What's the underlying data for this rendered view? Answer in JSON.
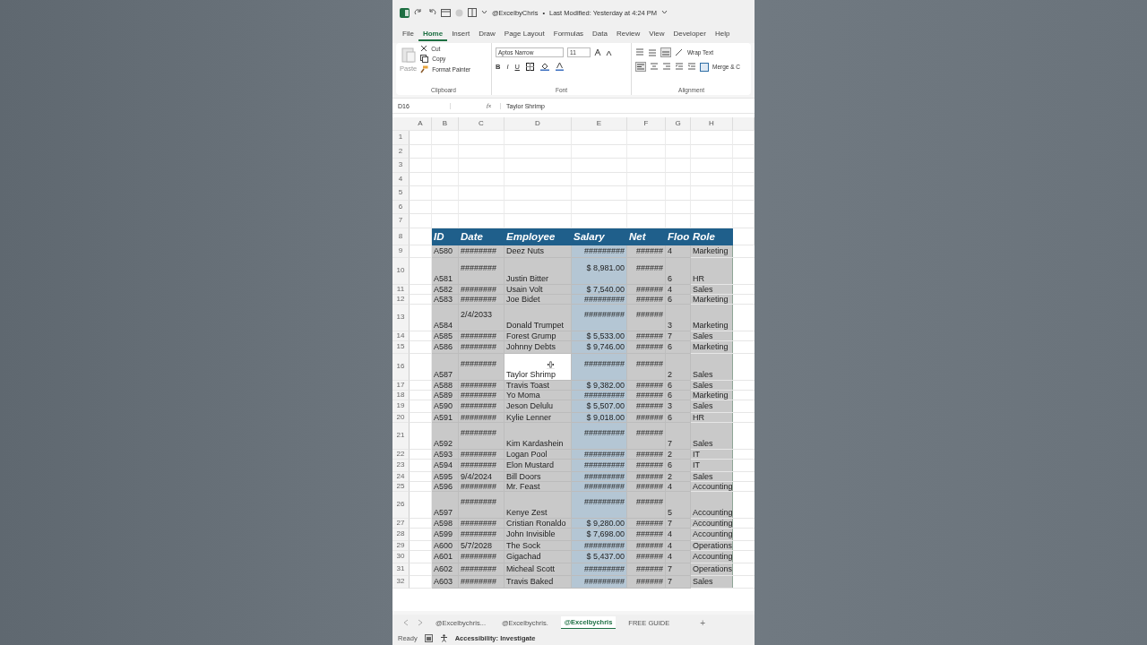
{
  "title_bar": {
    "file": "@ExcelbyChris",
    "separator": "•",
    "modified": "Last Modified: Yesterday at 4:24 PM"
  },
  "menu_tabs": [
    {
      "label": "File",
      "selected": false
    },
    {
      "label": "Home",
      "selected": true
    },
    {
      "label": "Insert",
      "selected": false
    },
    {
      "label": "Draw",
      "selected": false
    },
    {
      "label": "Page Layout",
      "selected": false
    },
    {
      "label": "Formulas",
      "selected": false
    },
    {
      "label": "Data",
      "selected": false
    },
    {
      "label": "Review",
      "selected": false
    },
    {
      "label": "View",
      "selected": false
    },
    {
      "label": "Developer",
      "selected": false
    },
    {
      "label": "Help",
      "selected": false
    }
  ],
  "ribbon": {
    "clipboard": {
      "paste": "Paste",
      "cut": "Cut",
      "copy": "Copy",
      "format_painter": "Format Painter",
      "group": "Clipboard"
    },
    "font": {
      "name": "Aptos Narrow",
      "size": "11",
      "bold": "B",
      "italic": "I",
      "underline": "U",
      "group": "Font"
    },
    "alignment": {
      "wrap": "Wrap Text",
      "merge": "Merge & C",
      "group": "Alignment"
    }
  },
  "formula_bar": {
    "cell": "D16",
    "fx": "fx",
    "value": "Taylor Shrimp"
  },
  "columns": [
    "A",
    "B",
    "C",
    "D",
    "E",
    "F",
    "G",
    "H"
  ],
  "empty_rows": [
    "1",
    "2",
    "3",
    "4",
    "5",
    "6",
    "7"
  ],
  "table": {
    "header_row": "8",
    "headers": [
      "ID",
      "Date",
      "Employee",
      "Salary",
      "Net",
      "Floo",
      "Role"
    ],
    "rows": [
      {
        "num": "9",
        "kind": "normal",
        "active": false,
        "cells": [
          "A580",
          "########",
          "Deez Nuts",
          "#########",
          "######",
          "4",
          "Marketing"
        ]
      },
      {
        "num": "10",
        "kind": "tall",
        "active": false,
        "cells": [
          "A581",
          "########",
          "Justin Bitter",
          "$ 8,981.00",
          "######",
          "6",
          "HR"
        ]
      },
      {
        "num": "11",
        "kind": "short",
        "active": false,
        "cells": [
          "A582",
          "########",
          "Usain Volt",
          "$ 7,540.00",
          "######",
          "4",
          "Sales"
        ]
      },
      {
        "num": "12",
        "kind": "short",
        "active": false,
        "cells": [
          "A583",
          "########",
          "Joe Bidet",
          "#########",
          "######",
          "6",
          "Marketing"
        ]
      },
      {
        "num": "13",
        "kind": "tall",
        "active": false,
        "cells": [
          "A584",
          "2/4/2033",
          "Donald Trumpet",
          "#########",
          "######",
          "3",
          "Marketing"
        ]
      },
      {
        "num": "14",
        "kind": "short",
        "active": false,
        "cells": [
          "A585",
          "########",
          "Forest Grump",
          "$ 5,533.00",
          "######",
          "7",
          "Sales"
        ]
      },
      {
        "num": "15",
        "kind": "normal",
        "active": false,
        "cells": [
          "A586",
          "########",
          "Johnny Debts",
          "$ 9,746.00",
          "######",
          "6",
          "Marketing"
        ]
      },
      {
        "num": "16",
        "kind": "tall",
        "active": true,
        "cells": [
          "A587",
          "########",
          "Taylor Shrimp",
          "#########",
          "######",
          "2",
          "Sales"
        ]
      },
      {
        "num": "17",
        "kind": "short",
        "active": false,
        "cells": [
          "A588",
          "########",
          "Travis Toast",
          "$ 9,382.00",
          "######",
          "6",
          "Sales"
        ]
      },
      {
        "num": "18",
        "kind": "short",
        "active": false,
        "cells": [
          "A589",
          "########",
          "Yo Moma",
          "#########",
          "######",
          "6",
          "Marketing"
        ]
      },
      {
        "num": "19",
        "kind": "normal",
        "active": false,
        "cells": [
          "A590",
          "########",
          "Jeson Delulu",
          "$ 5,507.00",
          "######",
          "3",
          "Sales"
        ]
      },
      {
        "num": "20",
        "kind": "short",
        "active": false,
        "cells": [
          "A591",
          "########",
          "Kylie Lenner",
          "$ 9,018.00",
          "######",
          "6",
          "HR"
        ]
      },
      {
        "num": "21",
        "kind": "tall",
        "active": false,
        "cells": [
          "A592",
          "########",
          "Kim Kardashein",
          "#########",
          "######",
          "7",
          "Sales"
        ]
      },
      {
        "num": "22",
        "kind": "short",
        "active": false,
        "cells": [
          "A593",
          "########",
          "Logan Pool",
          "#########",
          "######",
          "2",
          "IT"
        ]
      },
      {
        "num": "23",
        "kind": "normal",
        "active": false,
        "cells": [
          "A594",
          "########",
          "Elon Mustard",
          "#########",
          "######",
          "6",
          "IT"
        ]
      },
      {
        "num": "24",
        "kind": "short",
        "active": false,
        "cells": [
          "A595",
          "9/4/2024",
          "Bill Doors",
          "#########",
          "######",
          "2",
          "Sales"
        ]
      },
      {
        "num": "25",
        "kind": "short",
        "active": false,
        "cells": [
          "A596",
          "########",
          "Mr. Feast",
          "#########",
          "######",
          "4",
          "Accounting"
        ]
      },
      {
        "num": "26",
        "kind": "tall",
        "active": false,
        "cells": [
          "A597",
          "########",
          "Kenye Zest",
          "#########",
          "######",
          "5",
          "Accounting"
        ]
      },
      {
        "num": "27",
        "kind": "short",
        "active": false,
        "cells": [
          "A598",
          "########",
          "Cristian Ronaldo",
          "$ 9,280.00",
          "######",
          "7",
          "Accounting"
        ]
      },
      {
        "num": "28",
        "kind": "normal",
        "active": false,
        "cells": [
          "A599",
          "########",
          "John Invisible",
          "$ 7,698.00",
          "######",
          "4",
          "Accounting"
        ]
      },
      {
        "num": "29",
        "kind": "short",
        "active": false,
        "cells": [
          "A600",
          "5/7/2028",
          "The Sock",
          "#########",
          "######",
          "4",
          "Operations"
        ]
      },
      {
        "num": "30",
        "kind": "normal",
        "active": false,
        "cells": [
          "A601",
          "########",
          "Gigachad",
          "$ 5,437.00",
          "######",
          "4",
          "Accounting"
        ]
      },
      {
        "num": "31",
        "kind": "normal",
        "active": false,
        "cells": [
          "A602",
          "########",
          "Micheal Scott",
          "#########",
          "######",
          "7",
          "Operations"
        ]
      },
      {
        "num": "32",
        "kind": "normal",
        "active": false,
        "cells": [
          "A603",
          "########",
          "Travis Baked",
          "#########",
          "######",
          "7",
          "Sales"
        ]
      }
    ]
  },
  "sheet_tabs": [
    {
      "label": "@Excelbychris...",
      "selected": false
    },
    {
      "label": "@Excelbychris.",
      "selected": false
    },
    {
      "label": "@Excelbychris",
      "selected": true
    },
    {
      "label": "FREE GUIDE",
      "selected": false
    }
  ],
  "add_sheet": "+",
  "status": {
    "ready": "Ready",
    "accessibility": "Accessibility: Investigate"
  }
}
